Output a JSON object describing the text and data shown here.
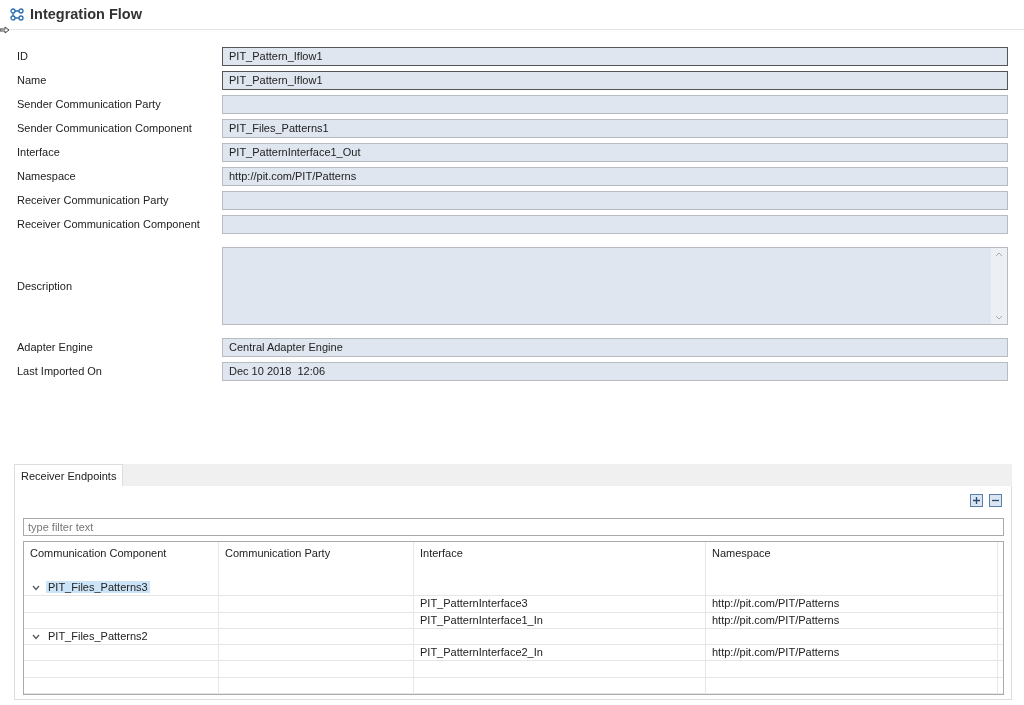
{
  "editor": {
    "title": "Integration Flow"
  },
  "fields": [
    {
      "label": "ID",
      "value": "PIT_Pattern_Iflow1",
      "kind": "text",
      "emphasized": true
    },
    {
      "label": "Name",
      "value": "PIT_Pattern_Iflow1",
      "kind": "text",
      "emphasized": true
    },
    {
      "label": "Sender Communication Party",
      "kind": "text",
      "emphasized": false
    },
    {
      "label": "Sender Communication Component",
      "value": "PIT_Files_Patterns1",
      "kind": "text",
      "emphasized": false
    },
    {
      "label": "Interface",
      "value": "PIT_PatternInterface1_Out",
      "kind": "text",
      "emphasized": false
    },
    {
      "label": "Namespace",
      "value": "http://pit.com/PIT/Patterns",
      "kind": "text",
      "emphasized": false
    },
    {
      "label": "Receiver Communication Party",
      "kind": "text",
      "emphasized": false
    },
    {
      "label": "Receiver Communication Component",
      "kind": "text",
      "emphasized": false
    },
    {
      "label": "Description",
      "kind": "textarea",
      "emphasized": false
    },
    {
      "label": "Adapter Engine",
      "value": "Central Adapter Engine",
      "kind": "text",
      "emphasized": false
    },
    {
      "label": "Last Imported On",
      "value": "Dec 10 2018  12:06",
      "kind": "text",
      "emphasized": false
    }
  ],
  "tabs": [
    {
      "label": "Receiver Endpoints",
      "selected": true
    }
  ],
  "filter": {
    "placeholder": "type filter text"
  },
  "table": {
    "columns": [
      "Communication Component",
      "Communication Party",
      "Interface",
      "Namespace"
    ],
    "rows": [
      {
        "component": "PIT_Files_Patterns3",
        "expanded": true,
        "selected": true,
        "children": [
          {
            "interface": "PIT_PatternInterface3",
            "namespace": "http://pit.com/PIT/Patterns"
          },
          {
            "interface": "PIT_PatternInterface1_In",
            "namespace": "http://pit.com/PIT/Patterns"
          }
        ]
      },
      {
        "component": "PIT_Files_Patterns2",
        "expanded": true,
        "selected": false,
        "children": [
          {
            "interface": "PIT_PatternInterface2_In",
            "namespace": "http://pit.com/PIT/Patterns"
          }
        ]
      }
    ]
  }
}
